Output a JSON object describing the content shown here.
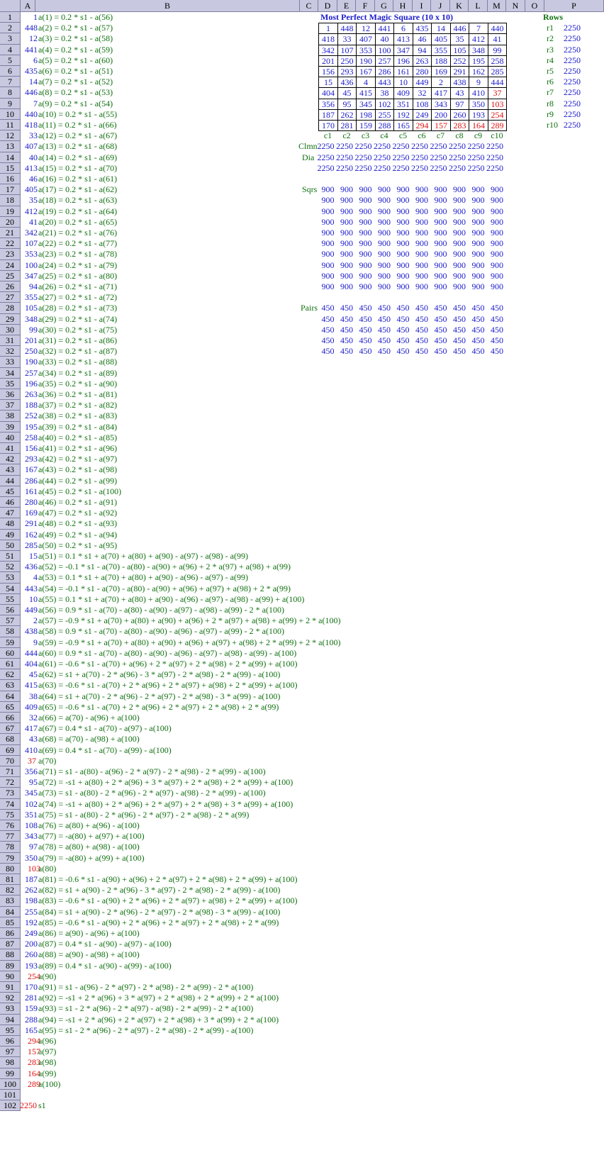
{
  "columns": [
    "A",
    "B",
    "C",
    "D",
    "E",
    "F",
    "G",
    "H",
    "I",
    "J",
    "K",
    "L",
    "M",
    "N",
    "O",
    "P"
  ],
  "title": "Most Perfect Magic Square (10 x 10)",
  "rows_label": "Rows",
  "square": [
    [
      1,
      448,
      12,
      441,
      6,
      435,
      14,
      446,
      7,
      440
    ],
    [
      418,
      33,
      407,
      40,
      413,
      46,
      405,
      35,
      412,
      41
    ],
    [
      342,
      107,
      353,
      100,
      347,
      94,
      355,
      105,
      348,
      99
    ],
    [
      201,
      250,
      190,
      257,
      196,
      263,
      188,
      252,
      195,
      258
    ],
    [
      156,
      293,
      167,
      286,
      161,
      280,
      169,
      291,
      162,
      285
    ],
    [
      15,
      436,
      4,
      443,
      10,
      449,
      2,
      438,
      9,
      444
    ],
    [
      404,
      45,
      415,
      38,
      409,
      32,
      417,
      43,
      410,
      37
    ],
    [
      356,
      95,
      345,
      102,
      351,
      108,
      343,
      97,
      350,
      103
    ],
    [
      187,
      262,
      198,
      255,
      192,
      249,
      200,
      260,
      193,
      254
    ],
    [
      170,
      281,
      159,
      288,
      165,
      294,
      157,
      283,
      164,
      289
    ]
  ],
  "red_cells": [
    [
      6,
      9
    ],
    [
      7,
      9
    ],
    [
      8,
      9
    ],
    [
      9,
      5
    ],
    [
      9,
      6
    ],
    [
      9,
      7
    ],
    [
      9,
      8
    ],
    [
      9,
      9
    ]
  ],
  "row_labels": [
    "r1",
    "r2",
    "r3",
    "r4",
    "r5",
    "r6",
    "r7",
    "r8",
    "r9",
    "r10"
  ],
  "row_sums": [
    2250,
    2250,
    2250,
    2250,
    2250,
    2250,
    2250,
    2250,
    2250,
    2250
  ],
  "col_labels": [
    "c1",
    "c2",
    "c3",
    "c4",
    "c5",
    "c6",
    "c7",
    "c8",
    "c9",
    "c10"
  ],
  "clmn_label": "Clmn",
  "dia_label": "Dia",
  "clmn_values": [
    2250,
    2250,
    2250,
    2250,
    2250,
    2250,
    2250,
    2250,
    2250,
    2250
  ],
  "dia_values": [
    2250,
    2250,
    2250,
    2250,
    2250,
    2250,
    2250,
    2250,
    2250,
    2250
  ],
  "dia2_values": [
    2250,
    2250,
    2250,
    2250,
    2250,
    2250,
    2250,
    2250,
    2250,
    2250
  ],
  "sqrs_label": "Sqrs",
  "sqrs_value": 900,
  "sqrs_rows": 10,
  "pairs_label": "Pairs",
  "pairs_value": 450,
  "pairs_rows": 5,
  "s1_value": "2250",
  "s1_label": "s1",
  "entries": [
    [
      "1",
      "a(1) = 0.2 * s1 - a(56)",
      "blue"
    ],
    [
      "448",
      "a(2) = 0.2 * s1 - a(57)",
      "blue"
    ],
    [
      "12",
      "a(3) = 0.2 * s1 - a(58)",
      "blue"
    ],
    [
      "441",
      "a(4) = 0.2 * s1 - a(59)",
      "blue"
    ],
    [
      "6",
      "a(5) = 0.2 * s1 - a(60)",
      "blue"
    ],
    [
      "435",
      "a(6) = 0.2 * s1 - a(51)",
      "blue"
    ],
    [
      "14",
      "a(7) = 0.2 * s1 - a(52)",
      "blue"
    ],
    [
      "446",
      "a(8) = 0.2 * s1 - a(53)",
      "blue"
    ],
    [
      "7",
      "a(9) = 0.2 * s1 - a(54)",
      "blue"
    ],
    [
      "440",
      "a(10) = 0.2 * s1 - a(55)",
      "blue"
    ],
    [
      "418",
      "a(11) = 0.2 * s1 - a(66)",
      "blue"
    ],
    [
      "33",
      "a(12) = 0.2 * s1 - a(67)",
      "blue"
    ],
    [
      "407",
      "a(13) = 0.2 * s1 - a(68)",
      "blue"
    ],
    [
      "40",
      "a(14) = 0.2 * s1 - a(69)",
      "blue"
    ],
    [
      "413",
      "a(15) = 0.2 * s1 - a(70)",
      "blue"
    ],
    [
      "46",
      "a(16) = 0.2 * s1 - a(61)",
      "blue"
    ],
    [
      "405",
      "a(17) = 0.2 * s1 - a(62)",
      "blue"
    ],
    [
      "35",
      "a(18) = 0.2 * s1 - a(63)",
      "blue"
    ],
    [
      "412",
      "a(19) = 0.2 * s1 - a(64)",
      "blue"
    ],
    [
      "41",
      "a(20) = 0.2 * s1 - a(65)",
      "blue"
    ],
    [
      "342",
      "a(21) = 0.2 * s1 - a(76)",
      "blue"
    ],
    [
      "107",
      "a(22) = 0.2 * s1 - a(77)",
      "blue"
    ],
    [
      "353",
      "a(23) = 0.2 * s1 - a(78)",
      "blue"
    ],
    [
      "100",
      "a(24) = 0.2 * s1 - a(79)",
      "blue"
    ],
    [
      "347",
      "a(25) = 0.2 * s1 - a(80)",
      "blue"
    ],
    [
      "94",
      "a(26) = 0.2 * s1 - a(71)",
      "blue"
    ],
    [
      "355",
      "a(27) = 0.2 * s1 - a(72)",
      "blue"
    ],
    [
      "105",
      "a(28) = 0.2 * s1 - a(73)",
      "blue"
    ],
    [
      "348",
      "a(29) = 0.2 * s1 - a(74)",
      "blue"
    ],
    [
      "99",
      "a(30) = 0.2 * s1 - a(75)",
      "blue"
    ],
    [
      "201",
      "a(31) = 0.2 * s1 - a(86)",
      "blue"
    ],
    [
      "250",
      "a(32) = 0.2 * s1 - a(87)",
      "blue"
    ],
    [
      "190",
      "a(33) = 0.2 * s1 - a(88)",
      "blue"
    ],
    [
      "257",
      "a(34) = 0.2 * s1 - a(89)",
      "blue"
    ],
    [
      "196",
      "a(35) = 0.2 * s1 - a(90)",
      "blue"
    ],
    [
      "263",
      "a(36) = 0.2 * s1 - a(81)",
      "blue"
    ],
    [
      "188",
      "a(37) = 0.2 * s1 - a(82)",
      "blue"
    ],
    [
      "252",
      "a(38) = 0.2 * s1 - a(83)",
      "blue"
    ],
    [
      "195",
      "a(39) = 0.2 * s1 - a(84)",
      "blue"
    ],
    [
      "258",
      "a(40) = 0.2 * s1 - a(85)",
      "blue"
    ],
    [
      "156",
      "a(41) = 0.2 * s1 - a(96)",
      "blue"
    ],
    [
      "293",
      "a(42) = 0.2 * s1 - a(97)",
      "blue"
    ],
    [
      "167",
      "a(43) = 0.2 * s1 - a(98)",
      "blue"
    ],
    [
      "286",
      "a(44) = 0.2 * s1 - a(99)",
      "blue"
    ],
    [
      "161",
      "a(45) = 0.2 * s1 - a(100)",
      "blue"
    ],
    [
      "280",
      "a(46) = 0.2 * s1 - a(91)",
      "blue"
    ],
    [
      "169",
      "a(47) = 0.2 * s1 - a(92)",
      "blue"
    ],
    [
      "291",
      "a(48) = 0.2 * s1 - a(93)",
      "blue"
    ],
    [
      "162",
      "a(49) = 0.2 * s1 - a(94)",
      "blue"
    ],
    [
      "285",
      "a(50) = 0.2 * s1 - a(95)",
      "blue"
    ],
    [
      "15",
      "a(51) = 0.1 * s1 + a(70) + a(80) + a(90) - a(97) - a(98) - a(99)",
      "blue"
    ],
    [
      "436",
      "a(52) = -0.1 * s1 - a(70) - a(80) - a(90) + a(96) + 2 * a(97) + a(98) + a(99)",
      "blue"
    ],
    [
      "4",
      "a(53) = 0.1 * s1 + a(70) + a(80) + a(90) - a(96) - a(97) - a(99)",
      "blue"
    ],
    [
      "443",
      "a(54) = -0.1 * s1 - a(70) - a(80) - a(90) + a(96) + a(97) + a(98) + 2 * a(99)",
      "blue"
    ],
    [
      "10",
      "a(55) = 0.1 * s1 + a(70) + a(80) + a(90) - a(96) - a(97) - a(98) - a(99) + a(100)",
      "blue"
    ],
    [
      "449",
      "a(56) = 0.9 * s1 - a(70) - a(80) - a(90) - a(97) - a(98) - a(99) - 2 * a(100)",
      "blue"
    ],
    [
      "2",
      "a(57) = -0.9 * s1 + a(70) + a(80) + a(90) + a(96) + 2 * a(97) + a(98) + a(99) + 2 * a(100)",
      "blue"
    ],
    [
      "438",
      "a(58) = 0.9 * s1 - a(70) - a(80) - a(90) - a(96) - a(97) - a(99) - 2 * a(100)",
      "blue"
    ],
    [
      "9",
      "a(59) = -0.9 * s1 + a(70) + a(80) + a(90) + a(96) + a(97) + a(98) + 2 * a(99) + 2 * a(100)",
      "blue"
    ],
    [
      "444",
      "a(60) = 0.9 * s1 - a(70) - a(80) - a(90) - a(96) - a(97) - a(98) - a(99) - a(100)",
      "blue"
    ],
    [
      "404",
      "a(61) = -0.6 * s1 - a(70) + a(96) + 2 * a(97) + 2 * a(98) + 2 * a(99) + a(100)",
      "blue"
    ],
    [
      "45",
      "a(62) = s1 + a(70) - 2 * a(96) - 3 * a(97) - 2 * a(98) - 2 * a(99) - a(100)",
      "blue"
    ],
    [
      "415",
      "a(63) = -0.6 * s1 - a(70) + 2 * a(96) + 2 * a(97) + a(98) + 2 * a(99) + a(100)",
      "blue"
    ],
    [
      "38",
      "a(64) = s1 + a(70) - 2 * a(96) - 2 * a(97) - 2 * a(98) - 3 * a(99) - a(100)",
      "blue"
    ],
    [
      "409",
      "a(65) = -0.6 * s1 - a(70) + 2 * a(96) + 2 * a(97) + 2 * a(98) + 2 * a(99)",
      "blue"
    ],
    [
      "32",
      "a(66) = a(70) - a(96) + a(100)",
      "blue"
    ],
    [
      "417",
      "a(67) = 0.4 * s1 - a(70) - a(97) - a(100)",
      "blue"
    ],
    [
      "43",
      "a(68) = a(70) - a(98) + a(100)",
      "blue"
    ],
    [
      "410",
      "a(69) = 0.4 * s1 - a(70) - a(99) - a(100)",
      "blue"
    ],
    [
      "37",
      "a(70)",
      "red"
    ],
    [
      "356",
      "a(71) = s1 - a(80) - a(96) - 2 * a(97) - 2 * a(98) - 2 * a(99) - a(100)",
      "blue"
    ],
    [
      "95",
      "a(72) = -s1 + a(80) + 2 * a(96) + 3 * a(97) + 2 * a(98) + 2 * a(99) + a(100)",
      "blue"
    ],
    [
      "345",
      "a(73) = s1 - a(80) - 2 * a(96) - 2 * a(97) - a(98) - 2 * a(99) - a(100)",
      "blue"
    ],
    [
      "102",
      "a(74) = -s1 + a(80) + 2 * a(96) + 2 * a(97) + 2 * a(98) + 3 * a(99) + a(100)",
      "blue"
    ],
    [
      "351",
      "a(75) = s1 - a(80) - 2 * a(96) - 2 * a(97) - 2 * a(98) - 2 * a(99)",
      "blue"
    ],
    [
      "108",
      "a(76) = a(80) + a(96) - a(100)",
      "blue"
    ],
    [
      "343",
      "a(77) = -a(80) + a(97) + a(100)",
      "blue"
    ],
    [
      "97",
      "a(78) = a(80) + a(98) - a(100)",
      "blue"
    ],
    [
      "350",
      "a(79) = -a(80) + a(99) + a(100)",
      "blue"
    ],
    [
      "103",
      "a(80)",
      "red"
    ],
    [
      "187",
      "a(81) = -0.6 * s1 - a(90) + a(96) + 2 * a(97) + 2 * a(98) + 2 * a(99) + a(100)",
      "blue"
    ],
    [
      "262",
      "a(82) = s1 + a(90) - 2 * a(96) - 3 * a(97) - 2 * a(98) - 2 * a(99) - a(100)",
      "blue"
    ],
    [
      "198",
      "a(83) = -0.6 * s1 - a(90) + 2 * a(96) + 2 * a(97) + a(98) + 2 * a(99) + a(100)",
      "blue"
    ],
    [
      "255",
      "a(84) = s1 + a(90) - 2 * a(96) - 2 * a(97) - 2 * a(98) - 3 * a(99) - a(100)",
      "blue"
    ],
    [
      "192",
      "a(85) = -0.6 * s1 - a(90) + 2 * a(96) + 2 * a(97) + 2 * a(98) + 2 * a(99)",
      "blue"
    ],
    [
      "249",
      "a(86) = a(90) - a(96) + a(100)",
      "blue"
    ],
    [
      "200",
      "a(87) = 0.4 * s1 - a(90) - a(97) - a(100)",
      "blue"
    ],
    [
      "260",
      "a(88) = a(90) - a(98) + a(100)",
      "blue"
    ],
    [
      "193",
      "a(89) = 0.4 * s1 - a(90) - a(99) - a(100)",
      "blue"
    ],
    [
      "254",
      "a(90)",
      "red"
    ],
    [
      "170",
      "a(91) = s1 - a(96) - 2 * a(97) - 2 * a(98) - 2 * a(99) - 2 * a(100)",
      "blue"
    ],
    [
      "281",
      "a(92) = -s1 + 2 * a(96) + 3 * a(97) + 2 * a(98) + 2 * a(99) + 2 * a(100)",
      "blue"
    ],
    [
      "159",
      "a(93) = s1 - 2 * a(96) - 2 * a(97) - a(98) - 2 * a(99) - 2 * a(100)",
      "blue"
    ],
    [
      "288",
      "a(94) = -s1 + 2 * a(96) + 2 * a(97) + 2 * a(98) + 3 * a(99) + 2 * a(100)",
      "blue"
    ],
    [
      "165",
      "a(95) = s1 - 2 * a(96) - 2 * a(97) - 2 * a(98) - 2 * a(99) - a(100)",
      "blue"
    ],
    [
      "294",
      "a(96)",
      "red"
    ],
    [
      "157",
      "a(97)",
      "red"
    ],
    [
      "283",
      "a(98)",
      "red"
    ],
    [
      "164",
      "a(99)",
      "red"
    ],
    [
      "289",
      "a(100)",
      "red"
    ]
  ]
}
